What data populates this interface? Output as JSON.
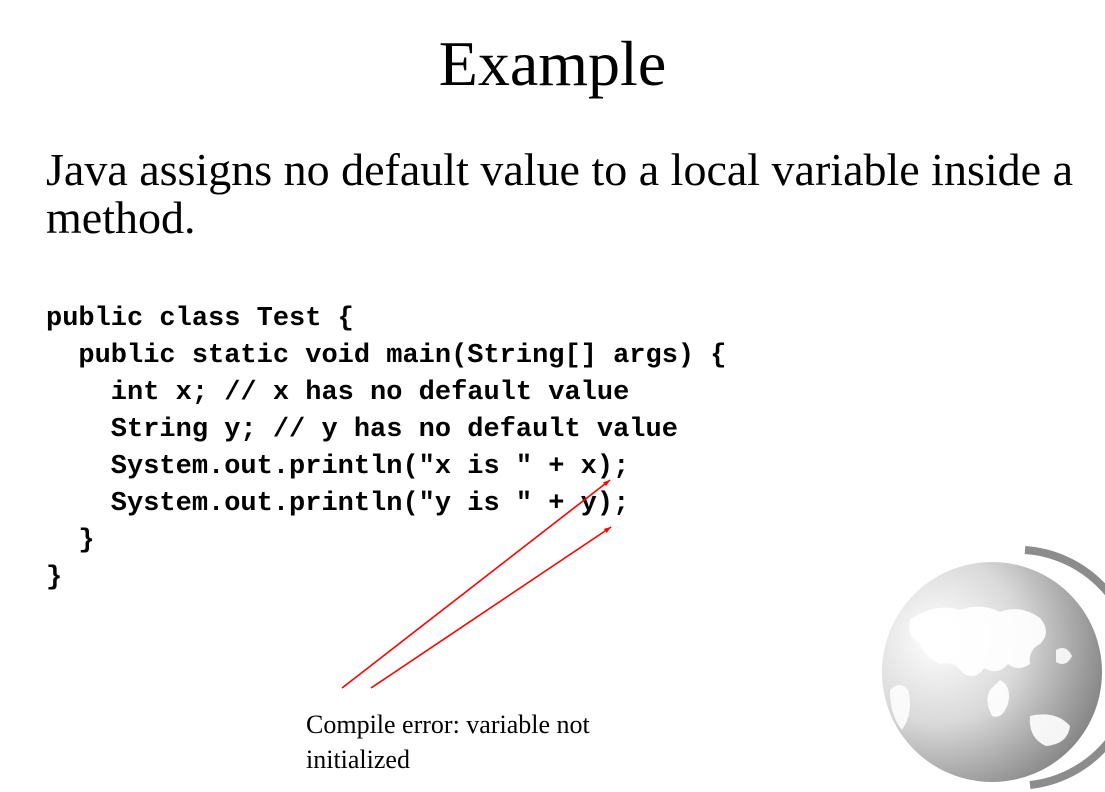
{
  "slide": {
    "title": "Example",
    "body_text": "Java assigns no default value to a local variable inside a method.",
    "code_lines": [
      "public class Test {",
      "  public static void main(String[] args) {",
      "    int x; // x has no default value",
      "    String y; // y has no default value",
      "    System.out.println(\"x is \" + x);",
      "    System.out.println(\"y is \" + y);",
      "  }",
      "}"
    ],
    "annotation": "Compile error: variable not initialized"
  },
  "colors": {
    "arrow": "#ff0000",
    "text": "#000000",
    "background": "#ffffff",
    "globe": "#8c8c8c"
  },
  "icons": {
    "decoration": "globe-icon"
  }
}
